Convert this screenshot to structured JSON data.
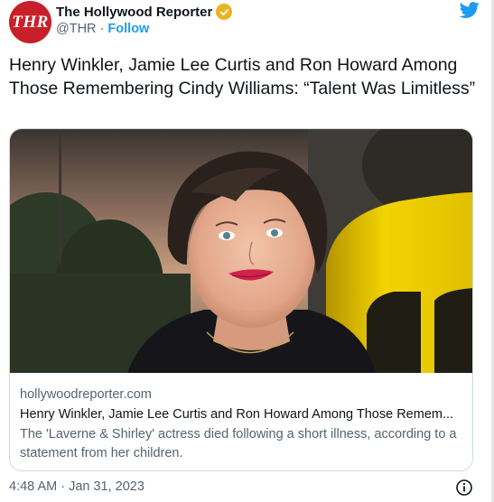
{
  "account": {
    "avatar_text": "THR",
    "display_name": "The Hollywood Reporter",
    "handle": "@THR",
    "separator": " · ",
    "follow_label": "Follow",
    "verified_icon": "verified-badge-icon",
    "platform_icon": "twitter-bird-icon"
  },
  "tweet": {
    "text": "Henry Winkler, Jamie Lee Curtis and Ron Howard Among Those Remembering Cindy Williams: “Talent Was Limitless”"
  },
  "card": {
    "domain": "hollywoodreporter.com",
    "title": "Henry Winkler, Jamie Lee Curtis and Ron Howard Among Those Remem...",
    "description": "The 'Laverne & Shirley' actress died following a short illness, according to a statement from her children."
  },
  "footer": {
    "timestamp": "4:48 AM · Jan 31, 2023",
    "info_icon": "info-icon"
  },
  "colors": {
    "brand_red": "#c8202a",
    "link_blue": "#1d9bf0",
    "verified_gold": "#e8b421",
    "muted_text": "#536471"
  }
}
